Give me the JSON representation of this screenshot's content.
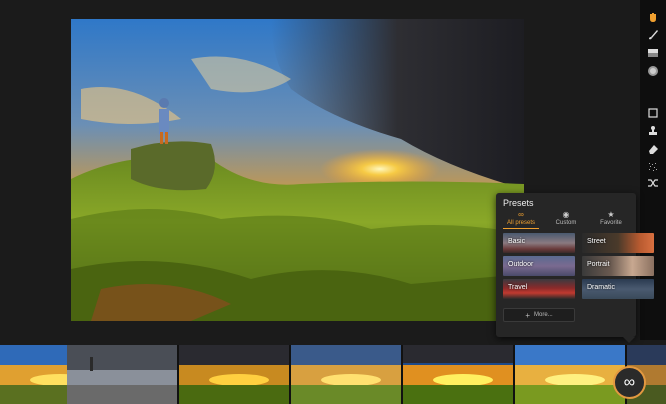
{
  "presets": {
    "title": "Presets",
    "tabs": [
      {
        "label": "All presets",
        "icon": "infinity-icon",
        "glyph": "∞"
      },
      {
        "label": "Custom",
        "icon": "user-icon",
        "glyph": "◉"
      },
      {
        "label": "Favorite",
        "icon": "star-icon",
        "glyph": "★"
      }
    ],
    "items": [
      {
        "label": "Basic"
      },
      {
        "label": "Street"
      },
      {
        "label": "Outdoor"
      },
      {
        "label": "Portrait"
      },
      {
        "label": "Travel"
      },
      {
        "label": "Dramatic"
      }
    ],
    "more_label": "More...",
    "more_glyph": "+"
  },
  "infinity_button": {
    "glyph": "∞"
  },
  "colors": {
    "accent": "#f0a030",
    "panel_bg": "#262626",
    "toolbar_bg": "#0e0e0e",
    "app_bg": "#1b1b1b"
  }
}
